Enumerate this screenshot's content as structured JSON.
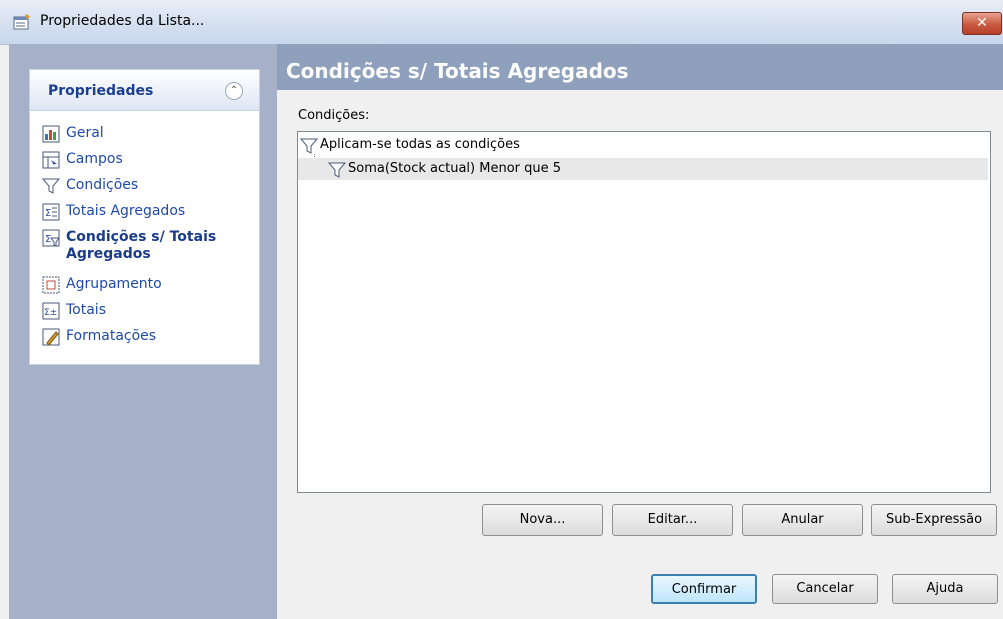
{
  "window": {
    "title": "Propriedades da Lista...",
    "close_label": "✕"
  },
  "sidebar": {
    "header": "Propriedades",
    "items": [
      {
        "label": "Geral",
        "icon": "general-icon",
        "active": false
      },
      {
        "label": "Campos",
        "icon": "fields-icon",
        "active": false
      },
      {
        "label": "Condições",
        "icon": "filter-icon",
        "active": false
      },
      {
        "label": "Totais Agregados",
        "icon": "aggregate-totals-icon",
        "active": false
      },
      {
        "label": "Condições s/ Totais Agregados",
        "icon": "aggregate-conditions-icon",
        "active": true
      },
      {
        "label": "Agrupamento",
        "icon": "grouping-icon",
        "active": false
      },
      {
        "label": "Totais",
        "icon": "totals-icon",
        "active": false
      },
      {
        "label": "Formatações",
        "icon": "formatting-icon",
        "active": false
      }
    ]
  },
  "main": {
    "title": "Condições s/ Totais Agregados",
    "conditions_label": "Condições:",
    "tree": {
      "root": "Aplicam-se todas as condições",
      "children": [
        "Soma(Stock actual) Menor que 5"
      ]
    },
    "buttons": {
      "new": "Nova...",
      "edit": "Editar...",
      "delete": "Anular",
      "subexpr": "Sub-Expressão"
    }
  },
  "footer": {
    "confirm": "Confirmar",
    "cancel": "Cancelar",
    "help": "Ajuda"
  },
  "colors": {
    "accent": "#1f4aa8",
    "sidebar_bg": "#a7b0c9",
    "header_bg": "#8fa0bd"
  }
}
